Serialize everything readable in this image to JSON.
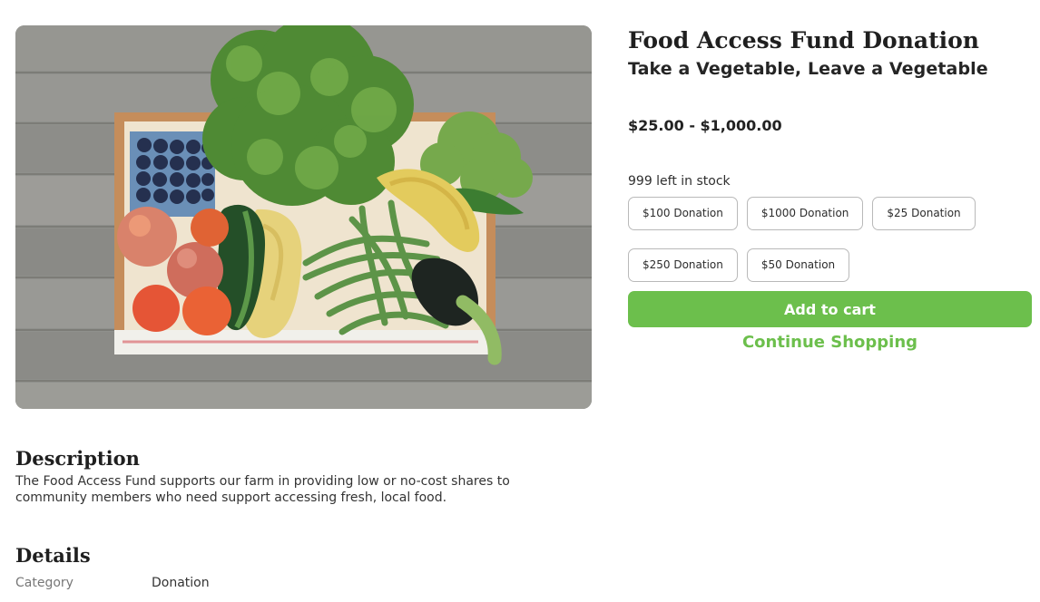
{
  "product": {
    "title": "Food Access Fund Donation",
    "subtitle": "Take a Vegetable, Leave a Vegetable",
    "price": "$25.00 - $1,000.00",
    "stock": "999 left in stock",
    "options": [
      "$100 Donation",
      "$1000 Donation",
      "$25 Donation",
      "$250 Donation",
      "$50 Donation"
    ],
    "add_to_cart_label": "Add to cart",
    "continue_shopping_label": "Continue Shopping"
  },
  "description": {
    "heading": "Description",
    "text": "The Food Access Fund supports our farm in providing low or no-cost shares to community members who need support accessing fresh, local food."
  },
  "details": {
    "heading": "Details",
    "category_label": "Category",
    "category_value": "Donation"
  },
  "colors": {
    "accent": "#6cbf4c",
    "text": "#222222",
    "border": "#b9b9b9"
  }
}
